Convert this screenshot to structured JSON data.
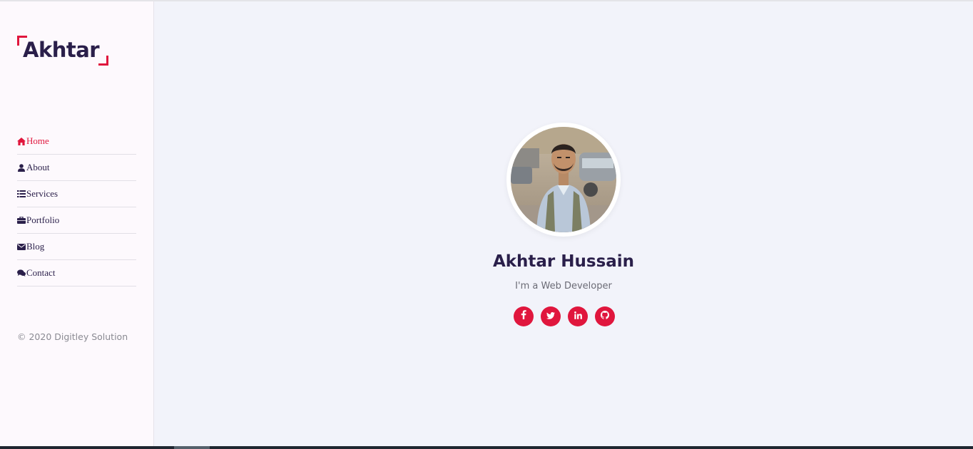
{
  "logo": {
    "text": "Akhtar"
  },
  "nav": {
    "items": [
      {
        "label": "Home",
        "icon": "home-icon",
        "active": true
      },
      {
        "label": "About",
        "icon": "user-icon",
        "active": false
      },
      {
        "label": "Services",
        "icon": "list-icon",
        "active": false
      },
      {
        "label": "Portfolio",
        "icon": "briefcase-icon",
        "active": false
      },
      {
        "label": "Blog",
        "icon": "envelope-icon",
        "active": false
      },
      {
        "label": "Contact",
        "icon": "comments-icon",
        "active": false
      }
    ]
  },
  "footer": {
    "copyright": "© 2020 Digitley Solution"
  },
  "profile": {
    "name": "Akhtar Hussain",
    "role": "I'm a Web Developer"
  },
  "social": [
    {
      "name": "facebook-icon",
      "glyph": "f"
    },
    {
      "name": "twitter-icon",
      "glyph": ""
    },
    {
      "name": "linkedin-icon",
      "glyph": "in"
    },
    {
      "name": "github-icon",
      "glyph": ""
    }
  ],
  "colors": {
    "accent": "#e0163d",
    "heading": "#2a1f4a",
    "sidebar_bg": "#fdf9fd",
    "main_bg": "#f2f3fa"
  }
}
